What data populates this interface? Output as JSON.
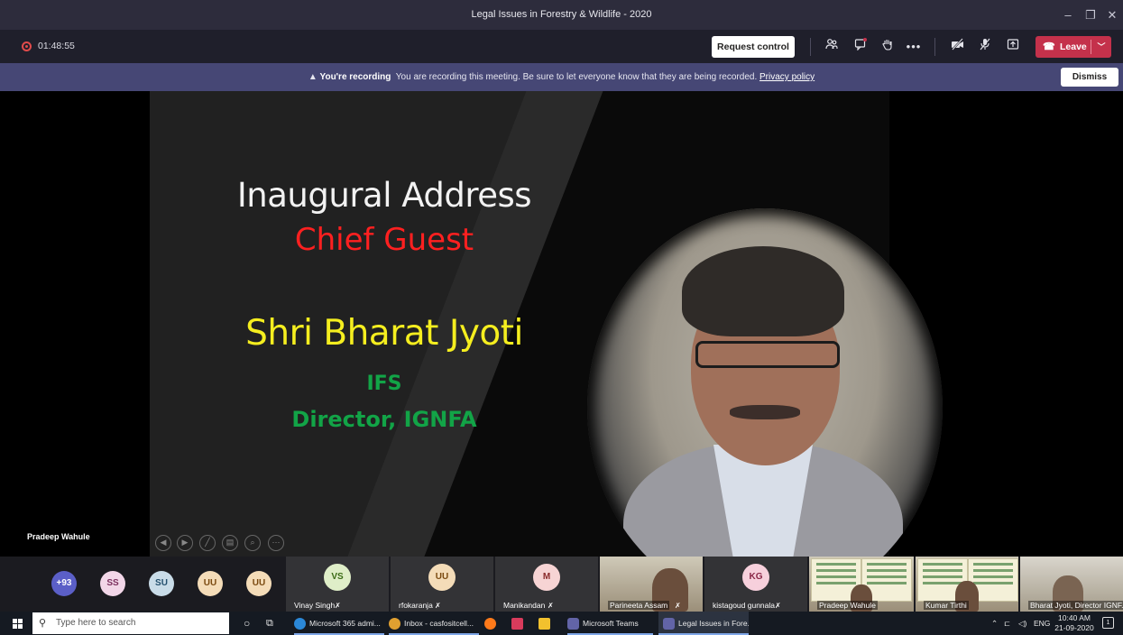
{
  "window": {
    "title": "Legal Issues in Forestry & Wildlife - 2020",
    "minimize": "–",
    "restore": "❐",
    "close": "✕"
  },
  "toolbar": {
    "timer": "01:48:55",
    "request_control": "Request control",
    "icons": [
      "people-icon",
      "chat-icon",
      "raise-hand-icon",
      "more-icon",
      "camera-off-icon",
      "mic-off-icon",
      "share-icon"
    ],
    "leave_label": "Leave"
  },
  "banner": {
    "bold": "You're recording",
    "message": "You are recording this meeting. Be sure to let everyone know that they are being recorded.",
    "link": "Privacy policy",
    "dismiss": "Dismiss"
  },
  "slide": {
    "line1": "Inaugural Address",
    "line2": "Chief Guest",
    "line3": "Shri Bharat Jyoti",
    "line4": "IFS",
    "line5": "Director, IGNFA",
    "colors": {
      "title": "#f2f2f2",
      "guest": "#ff2020",
      "name": "#f5ee1f",
      "designation": "#12a447"
    }
  },
  "presenter": "Pradeep Wahule",
  "roster": {
    "overflow": "+93",
    "small_avatars": [
      {
        "initials": "SS",
        "bg": "#f2d6e8",
        "fg": "#7b2f5e"
      },
      {
        "initials": "SU",
        "bg": "#c9dce8",
        "fg": "#24506e"
      },
      {
        "initials": "UU",
        "bg": "#f4dcb8",
        "fg": "#7a4a10"
      },
      {
        "initials": "UU",
        "bg": "#f4dcb8",
        "fg": "#7a4a10"
      }
    ],
    "tiles": [
      {
        "initials": "VS",
        "name": "Vinay Singh",
        "bg": "#dfeec8",
        "fg": "#3b6b16"
      },
      {
        "initials": "UU",
        "name": "rfokaranja",
        "bg": "#f4dcb8",
        "fg": "#7a4a10"
      },
      {
        "initials": "M",
        "name": "Manikandan",
        "bg": "#f7d4d4",
        "fg": "#8a2b2b"
      },
      {
        "name": "Parineeta Assam"
      },
      {
        "initials": "KG",
        "name": "kistagoud gunnala",
        "bg": "#f7d0dc",
        "fg": "#8a2747"
      },
      {
        "name": "Pradeep Wahule"
      },
      {
        "name": "Kumar Tirthi"
      },
      {
        "name": "Bharat Jyoti, Director IGNF..."
      }
    ]
  },
  "taskbar": {
    "search_placeholder": "Type here to search",
    "apps": [
      {
        "label": "Microsoft 365 admi...",
        "color": "#2b88d8"
      },
      {
        "label": "Inbox - casfositcell...",
        "color": "#e0a030"
      },
      {
        "label": "",
        "color": "#ff7a1a"
      },
      {
        "label": "",
        "color": "#d83b5c"
      },
      {
        "label": "",
        "color": "#f2c12e"
      },
      {
        "label": "Microsoft Teams",
        "color": "#6264a7"
      },
      {
        "label": "Legal Issues in Fore...",
        "color": "#6264a7"
      }
    ],
    "tray": "ENG",
    "time": "10:40 AM",
    "date": "21-09-2020"
  }
}
